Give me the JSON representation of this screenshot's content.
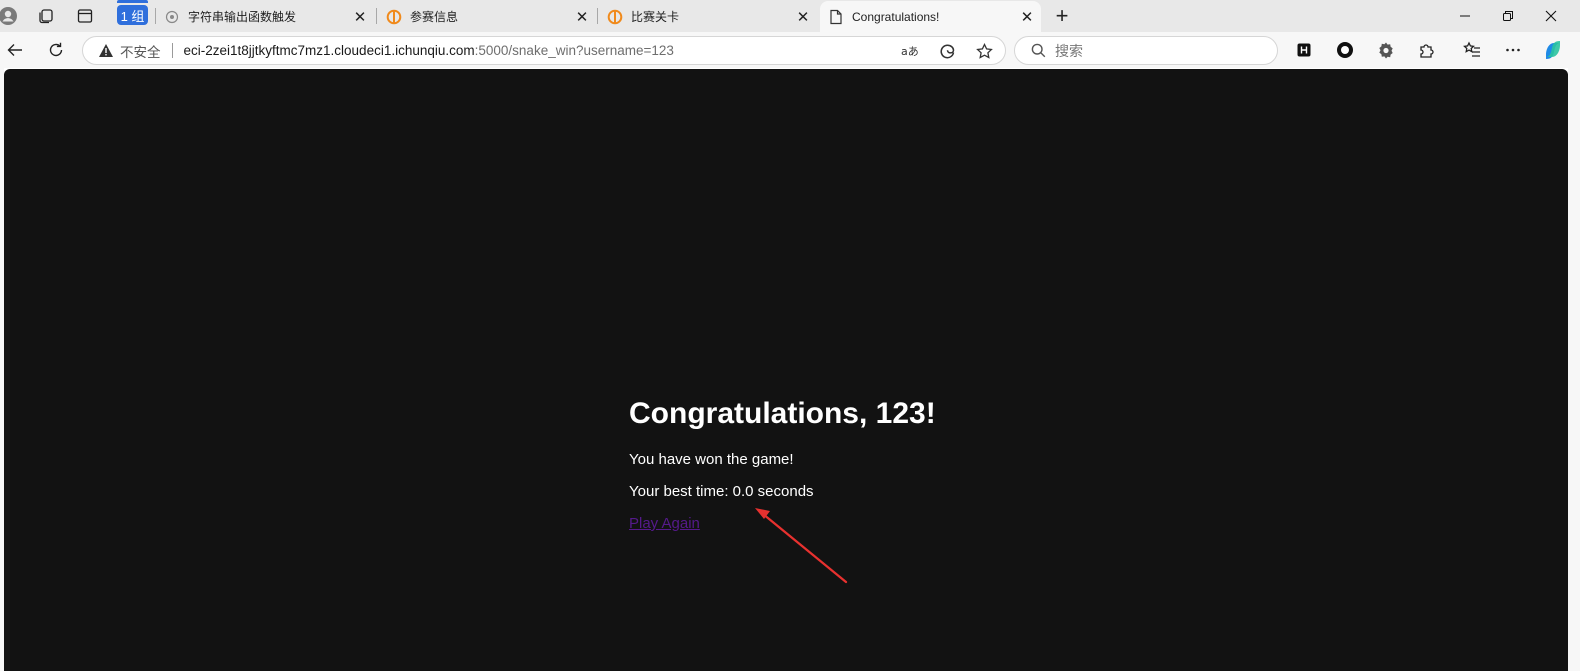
{
  "browser": {
    "tab_group_label": "1 组",
    "tabs": [
      {
        "title": "字符串输出函数触发",
        "icon": "settings-favicon"
      },
      {
        "title": "参赛信息",
        "icon": "ichunqiu-favicon"
      },
      {
        "title": "比赛关卡",
        "icon": "ichunqiu-favicon"
      },
      {
        "title": "Congratulations!",
        "icon": "page-favicon",
        "active": true
      }
    ],
    "address": {
      "security_label": "不安全",
      "host": "eci-2zei1t8jjtkyftmc7mz1.cloudeci1.ichunqiu.com",
      "path": ":5000/snake_win?username=123"
    },
    "search_placeholder": "搜索",
    "colors": {
      "accent": "#2f6fdc",
      "tabstrip_bg": "#e8e8e8",
      "toolbar_bg": "#f7f7f7",
      "page_bg": "#121212",
      "link": "#551a8b",
      "annotation_arrow": "#e8312f"
    }
  },
  "page": {
    "heading": "Congratulations, 123!",
    "win_message": "You have won the game!",
    "best_time": "Your best time: 0.0 seconds",
    "play_again_link": "Play Again"
  }
}
